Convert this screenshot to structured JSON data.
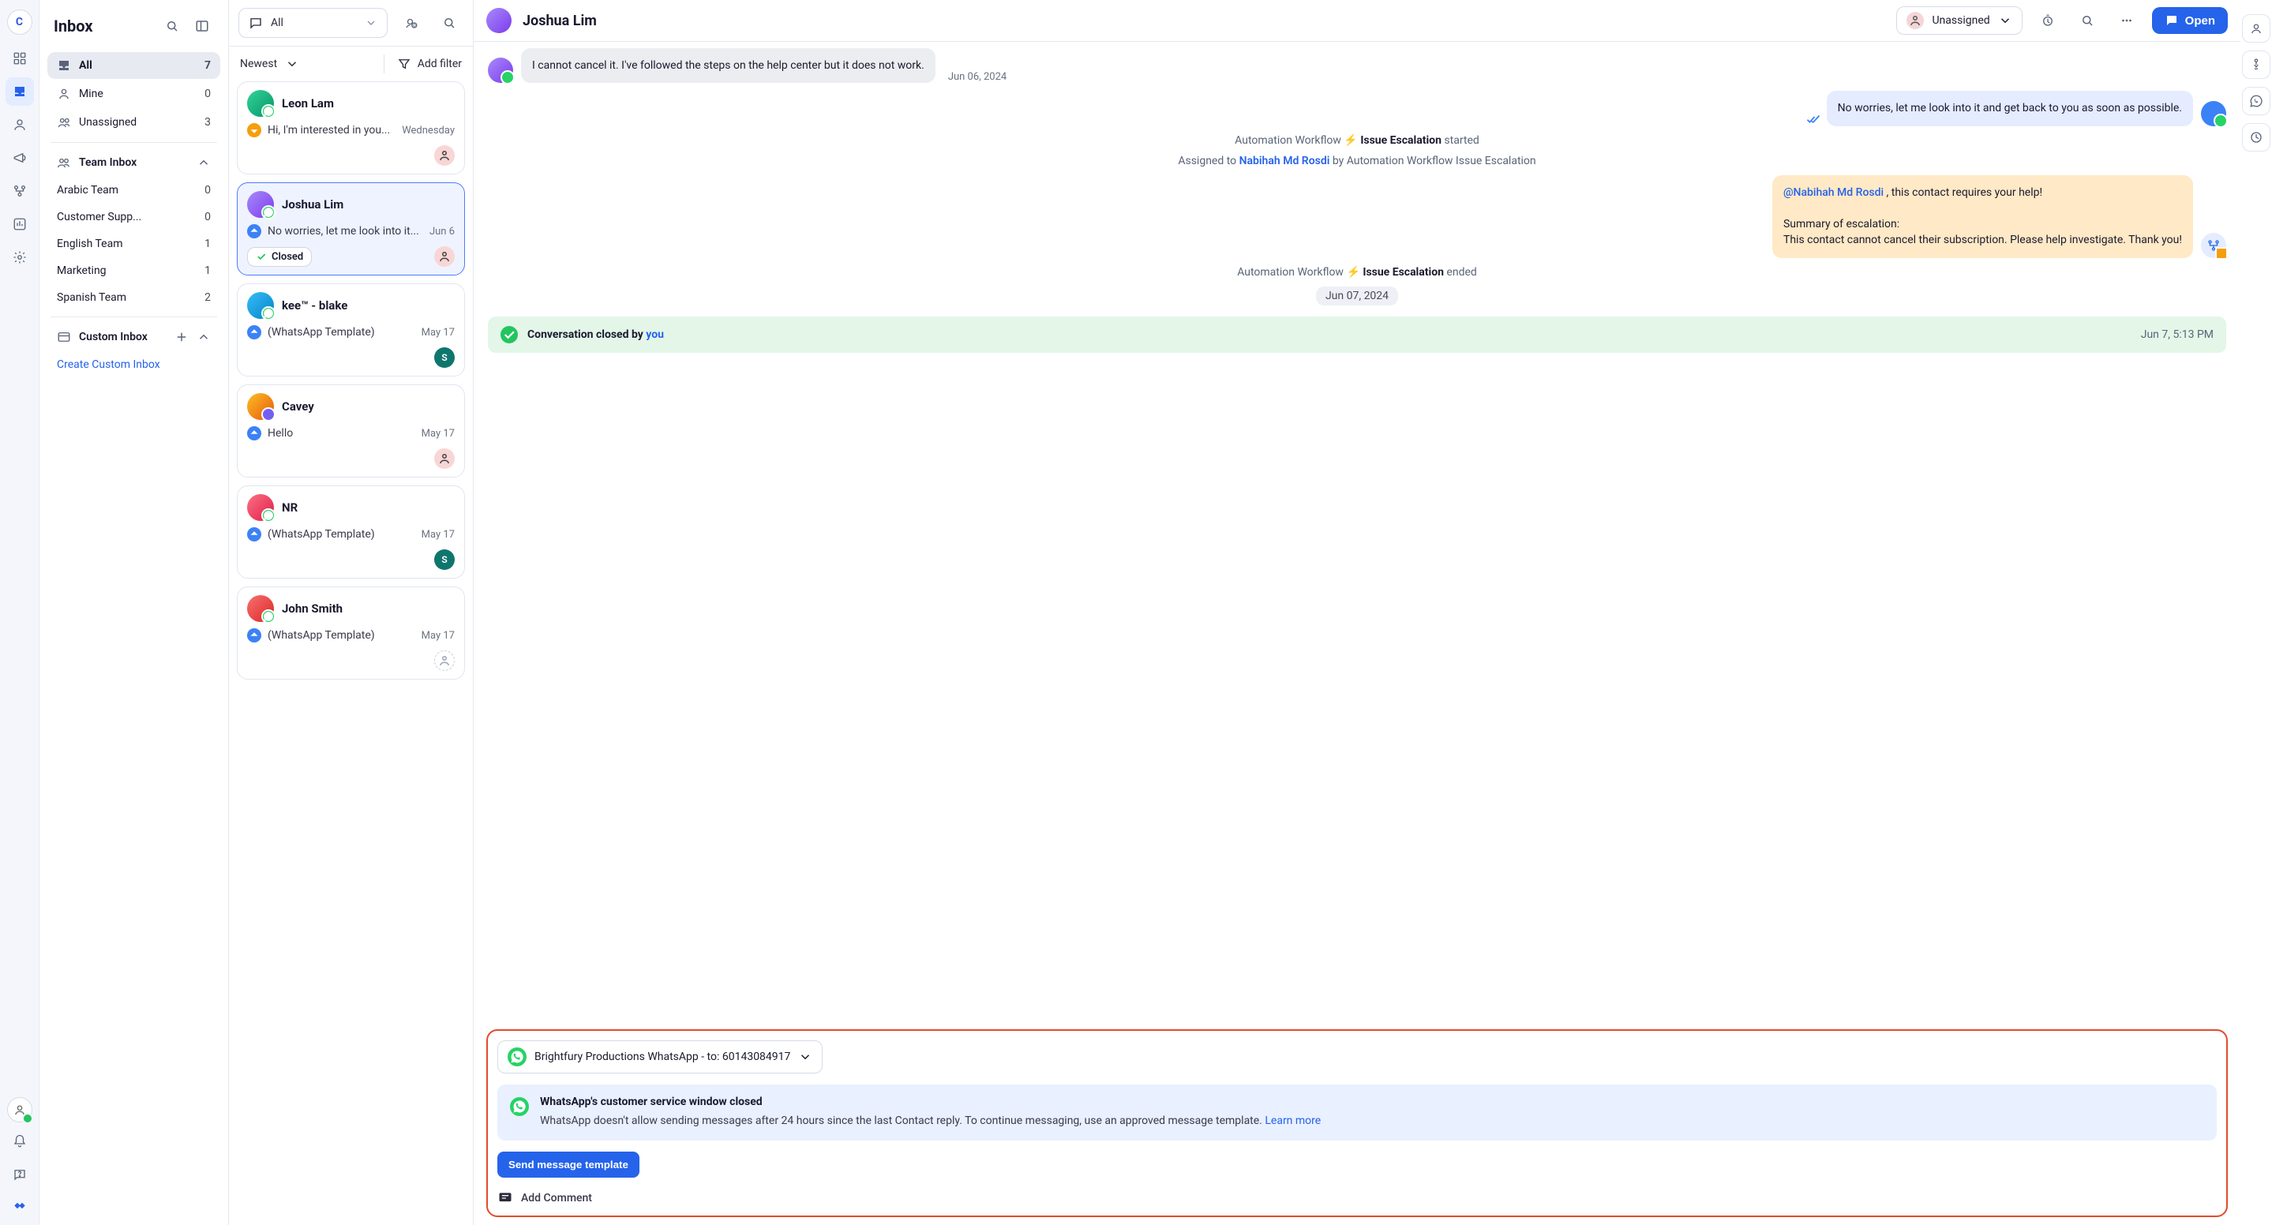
{
  "rail": {
    "brand_initial": "C"
  },
  "inbox": {
    "title": "Inbox",
    "folders": [
      {
        "icon": "inbox",
        "label": "All",
        "count": "7",
        "active": true
      },
      {
        "icon": "person",
        "label": "Mine",
        "count": "0"
      },
      {
        "icon": "group",
        "label": "Unassigned",
        "count": "3"
      }
    ],
    "team_inbox_label": "Team Inbox",
    "teams": [
      {
        "label": "Arabic Team",
        "count": "0"
      },
      {
        "label": "Customer Supp...",
        "count": "0"
      },
      {
        "label": "English Team",
        "count": "1"
      },
      {
        "label": "Marketing",
        "count": "1"
      },
      {
        "label": "Spanish Team",
        "count": "2"
      }
    ],
    "custom_inbox_label": "Custom Inbox",
    "create_custom_inbox": "Create Custom Inbox"
  },
  "list": {
    "filter_dropdown_label": "All",
    "sort_label": "Newest",
    "add_filter_label": "Add filter",
    "conversations": [
      {
        "name": "Leon Lam",
        "preview": "Hi, I'm interested in you...",
        "time": "Wednesday",
        "dir": "in",
        "channel": "wa",
        "assignee": "person",
        "avatar": "c1"
      },
      {
        "name": "Joshua Lim",
        "preview": "No worries, let me look into it...",
        "time": "Jun 6",
        "dir": "out",
        "channel": "wa",
        "assignee": "person",
        "avatar": "c2",
        "selected": true,
        "closed": true,
        "closed_label": "Closed"
      },
      {
        "name": "kee™ - blake",
        "preview": "(WhatsApp Template)",
        "time": "May 17",
        "dir": "out",
        "channel": "wa",
        "assignee": "S",
        "assignee_style": "gr",
        "avatar": "c3"
      },
      {
        "name": "Cavey",
        "preview": "Hello",
        "time": "May 17",
        "dir": "out",
        "channel": "viber",
        "assignee": "person",
        "avatar": "c4"
      },
      {
        "name": "NR",
        "preview": "(WhatsApp Template)",
        "time": "May 17",
        "dir": "out",
        "channel": "wa",
        "assignee": "S",
        "assignee_style": "gr",
        "avatar": "c5"
      },
      {
        "name": "John Smith",
        "preview": "(WhatsApp Template)",
        "time": "May 17",
        "dir": "out",
        "channel": "wa",
        "assignee": "dashed",
        "assignee_style": "bd",
        "avatar": "c6"
      }
    ]
  },
  "conversation": {
    "contact_name": "Joshua Lim",
    "assignee_label": "Unassigned",
    "open_button": "Open",
    "incoming_message": "I cannot cancel it. I've followed the steps on the help center but it does not work.",
    "incoming_date": "Jun 06, 2024",
    "reply_message": "No worries, let me look into it and get back to you as soon as possible.",
    "sys1_prefix": "Automation Workflow",
    "sys1_name": "Issue Escalation",
    "sys1_suffix": " started",
    "sys2_prefix": "Assigned to ",
    "sys2_link": "Nabihah Md Rosdi",
    "sys2_suffix": " by Automation Workflow Issue Escalation",
    "escal_mention": "@Nabihah Md Rosdi",
    "escal_line1": "  , this contact requires your help!",
    "escal_line2": "Summary of escalation:",
    "escal_line3": "This contact cannot cancel their subscription. Please help investigate. Thank you!",
    "sys3_prefix": "Automation Workflow",
    "sys3_name": "Issue Escalation",
    "sys3_suffix": " ended",
    "date_pill": "Jun 07, 2024",
    "closed_text_prefix": "Conversation closed by ",
    "closed_text_link": "you",
    "closed_ts": "Jun 7, 5:13 PM",
    "channel_dropdown": "Brightfury Productions WhatsApp - to: 60143084917",
    "wa_notice_title": "WhatsApp's customer service window closed",
    "wa_notice_desc": "WhatsApp doesn't allow sending messages after 24 hours since the last Contact reply. To continue messaging, use an approved message template. ",
    "wa_notice_link": "Learn more",
    "send_template_btn": "Send message template",
    "add_comment": "Add Comment"
  }
}
